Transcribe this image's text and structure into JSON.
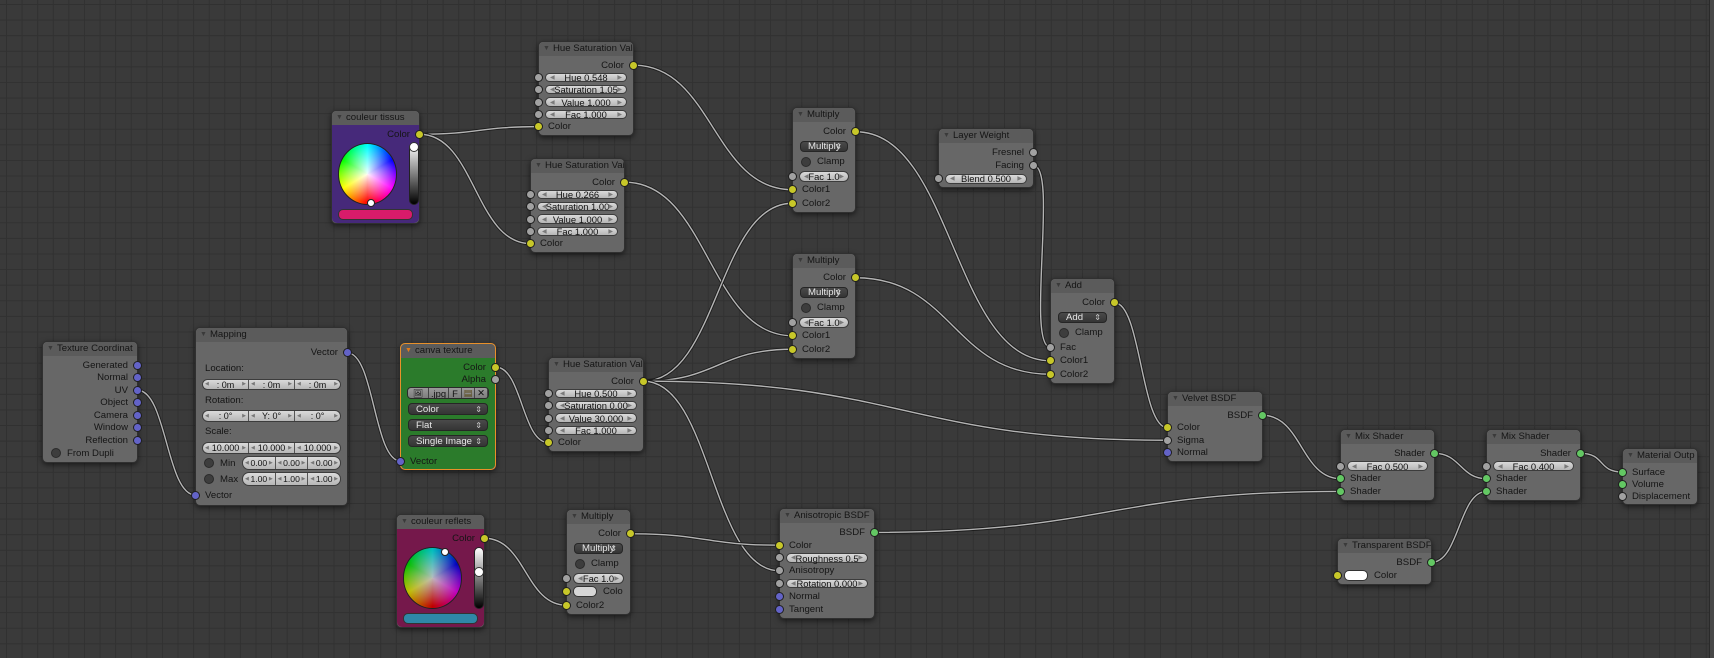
{
  "socket_colors": {
    "color": "#c7c729",
    "value": "#a1a1a1",
    "vector": "#6363c7",
    "shader": "#63c763"
  },
  "nodes": [
    {
      "id": "texcoord",
      "title": "Texture Coordinat",
      "rows": [
        {
          "t": "out",
          "label": "Generated",
          "sock": "vector"
        },
        {
          "t": "out",
          "label": "Normal",
          "sock": "vector"
        },
        {
          "t": "out",
          "label": "UV",
          "sock": "vector"
        },
        {
          "t": "out",
          "label": "Object",
          "sock": "vector"
        },
        {
          "t": "out",
          "label": "Camera",
          "sock": "vector"
        },
        {
          "t": "out",
          "label": "Window",
          "sock": "vector"
        },
        {
          "t": "out",
          "label": "Reflection",
          "sock": "vector"
        },
        {
          "t": "check",
          "label": "From Dupli"
        }
      ]
    },
    {
      "id": "mapping",
      "title": "Mapping",
      "rows": [
        {
          "t": "out",
          "label": "Vector",
          "sock": "vector"
        },
        {
          "t": "label",
          "label": "Location:"
        },
        {
          "t": "vec3",
          "values": [
            ": 0m",
            ": 0m",
            ": 0m"
          ]
        },
        {
          "t": "label",
          "label": "Rotation:"
        },
        {
          "t": "vec3",
          "values": [
            ": 0°",
            "Y: 0°",
            ": 0°"
          ]
        },
        {
          "t": "label",
          "label": "Scale:"
        },
        {
          "t": "vec3",
          "values": [
            "10.000",
            "10.000",
            "10.000"
          ]
        },
        {
          "t": "minmax",
          "label": "Min",
          "values": [
            "0.00",
            "0.00",
            "0.00"
          ]
        },
        {
          "t": "minmax",
          "label": "Max",
          "values": [
            "1.00",
            "1.00",
            "1.00"
          ]
        },
        {
          "t": "in",
          "label": "Vector",
          "sock": "vector"
        }
      ]
    },
    {
      "id": "canva",
      "title": "canva texture",
      "selected": true,
      "body_color": "#2b7b2b",
      "rows": [
        {
          "t": "out",
          "label": "Color",
          "sock": "color"
        },
        {
          "t": "out",
          "label": "Alpha",
          "sock": "value"
        },
        {
          "t": "imgbar",
          "ext": ".jpg",
          "f": "F"
        },
        {
          "t": "select",
          "label": "Color"
        },
        {
          "t": "select",
          "label": "Flat"
        },
        {
          "t": "select",
          "label": "Single Image"
        },
        {
          "t": "spacer"
        },
        {
          "t": "in",
          "label": "Vector",
          "sock": "vector"
        }
      ]
    },
    {
      "id": "tissus",
      "title": "couleur tissus",
      "body_color": "#46297a",
      "rows": [
        {
          "t": "out",
          "label": "Color",
          "sock": "color"
        },
        {
          "t": "picker",
          "value_level": 0.95,
          "dim": 0
        },
        {
          "t": "swatch",
          "color": "#d81b6a"
        }
      ]
    },
    {
      "id": "reflets",
      "title": "couleur reflets",
      "body_color": "#75184b",
      "rows": [
        {
          "t": "out",
          "label": "Color",
          "sock": "color"
        },
        {
          "t": "picker",
          "value_level": 0.6,
          "dim": 0.25
        },
        {
          "t": "swatch",
          "color": "#2f87a7"
        }
      ]
    },
    {
      "id": "hsv1",
      "title": "Hue Saturation Val",
      "rows": [
        {
          "t": "out",
          "label": "Color",
          "sock": "color"
        },
        {
          "t": "field",
          "name": "Hue",
          "value": "0.548",
          "sock": "value"
        },
        {
          "t": "field",
          "name": "Saturation",
          "value": "1.05",
          "sock": "value"
        },
        {
          "t": "field",
          "name": "Value",
          "value": "1.000",
          "sock": "value"
        },
        {
          "t": "field",
          "name": "Fac",
          "value": "1.000",
          "sock": "value"
        },
        {
          "t": "in",
          "label": "Color",
          "sock": "color"
        }
      ]
    },
    {
      "id": "hsv2",
      "title": "Hue Saturation Val",
      "rows": [
        {
          "t": "out",
          "label": "Color",
          "sock": "color"
        },
        {
          "t": "field",
          "name": "Hue",
          "value": "0.266",
          "sock": "value"
        },
        {
          "t": "field",
          "name": "Saturation",
          "value": "1.00",
          "sock": "value"
        },
        {
          "t": "field",
          "name": "Value",
          "value": "1.000",
          "sock": "value"
        },
        {
          "t": "field",
          "name": "Fac",
          "value": "1.000",
          "sock": "value"
        },
        {
          "t": "in",
          "label": "Color",
          "sock": "color"
        }
      ]
    },
    {
      "id": "hsv3",
      "title": "Hue Saturation Val",
      "rows": [
        {
          "t": "out",
          "label": "Color",
          "sock": "color"
        },
        {
          "t": "field",
          "name": "Hue",
          "value": "0.500",
          "sock": "value"
        },
        {
          "t": "field",
          "name": "Saturation",
          "value": "0.00",
          "sock": "value"
        },
        {
          "t": "field",
          "name": "Value",
          "value": "30.000",
          "sock": "value"
        },
        {
          "t": "field",
          "name": "Fac",
          "value": "1.000",
          "sock": "value"
        },
        {
          "t": "in",
          "label": "Color",
          "sock": "color"
        }
      ]
    },
    {
      "id": "mult1",
      "title": "Multiply",
      "rows": [
        {
          "t": "out",
          "label": "Color",
          "sock": "color"
        },
        {
          "t": "select",
          "label": "Multiply"
        },
        {
          "t": "check",
          "label": "Clamp"
        },
        {
          "t": "field",
          "name": "Fac",
          "value": "1.0",
          "sock": "value"
        },
        {
          "t": "in",
          "label": "Color1",
          "sock": "color"
        },
        {
          "t": "in",
          "label": "Color2",
          "sock": "color"
        }
      ]
    },
    {
      "id": "mult2",
      "title": "Multiply",
      "rows": [
        {
          "t": "out",
          "label": "Color",
          "sock": "color"
        },
        {
          "t": "select",
          "label": "Multiply"
        },
        {
          "t": "check",
          "label": "Clamp"
        },
        {
          "t": "field",
          "name": "Fac",
          "value": "1.0",
          "sock": "value"
        },
        {
          "t": "in",
          "label": "Color1",
          "sock": "color"
        },
        {
          "t": "in",
          "label": "Color2",
          "sock": "color"
        }
      ]
    },
    {
      "id": "mult3",
      "title": "Multiply",
      "rows": [
        {
          "t": "out",
          "label": "Color",
          "sock": "color"
        },
        {
          "t": "select",
          "label": "Multiply"
        },
        {
          "t": "check",
          "label": "Clamp"
        },
        {
          "t": "field",
          "name": "Fac",
          "value": "1.0",
          "sock": "value"
        },
        {
          "t": "colorin",
          "label": "Colo",
          "sock": "color",
          "swatch": "#d6d6d6"
        },
        {
          "t": "in",
          "label": "Color2",
          "sock": "color"
        }
      ]
    },
    {
      "id": "layer",
      "title": "Layer Weight",
      "rows": [
        {
          "t": "out",
          "label": "Fresnel",
          "sock": "value"
        },
        {
          "t": "out",
          "label": "Facing",
          "sock": "value"
        },
        {
          "t": "field",
          "name": "Blend",
          "value": "0.500",
          "sock": "value"
        }
      ]
    },
    {
      "id": "add",
      "title": "Add",
      "rows": [
        {
          "t": "out",
          "label": "Color",
          "sock": "color"
        },
        {
          "t": "select",
          "label": "Add"
        },
        {
          "t": "check",
          "label": "Clamp"
        },
        {
          "t": "in",
          "label": "Fac",
          "sock": "value"
        },
        {
          "t": "in",
          "label": "Color1",
          "sock": "color"
        },
        {
          "t": "in",
          "label": "Color2",
          "sock": "color"
        }
      ]
    },
    {
      "id": "velvet",
      "title": "Velvet BSDF",
      "rows": [
        {
          "t": "out",
          "label": "BSDF",
          "sock": "shader"
        },
        {
          "t": "in",
          "label": "Color",
          "sock": "color"
        },
        {
          "t": "in",
          "label": "Sigma",
          "sock": "value"
        },
        {
          "t": "in",
          "label": "Normal",
          "sock": "vector"
        }
      ]
    },
    {
      "id": "aniso",
      "title": "Anisotropic BSDF",
      "rows": [
        {
          "t": "out",
          "label": "BSDF",
          "sock": "shader"
        },
        {
          "t": "in",
          "label": "Color",
          "sock": "color"
        },
        {
          "t": "field",
          "name": "Roughness",
          "value": "0.5",
          "sock": "value"
        },
        {
          "t": "in",
          "label": "Anisotropy",
          "sock": "value"
        },
        {
          "t": "field",
          "name": "Rotation",
          "value": "0.000",
          "sock": "value"
        },
        {
          "t": "in",
          "label": "Normal",
          "sock": "vector"
        },
        {
          "t": "in",
          "label": "Tangent",
          "sock": "vector"
        }
      ]
    },
    {
      "id": "mix1",
      "title": "Mix Shader",
      "rows": [
        {
          "t": "out",
          "label": "Shader",
          "sock": "shader"
        },
        {
          "t": "field",
          "name": "Fac",
          "value": "0.500",
          "sock": "value"
        },
        {
          "t": "in",
          "label": "Shader",
          "sock": "shader"
        },
        {
          "t": "in",
          "label": "Shader",
          "sock": "shader"
        }
      ]
    },
    {
      "id": "mix2",
      "title": "Mix Shader",
      "rows": [
        {
          "t": "out",
          "label": "Shader",
          "sock": "shader"
        },
        {
          "t": "field",
          "name": "Fac",
          "value": "0.400",
          "sock": "value"
        },
        {
          "t": "in",
          "label": "Shader",
          "sock": "shader"
        },
        {
          "t": "in",
          "label": "Shader",
          "sock": "shader"
        }
      ]
    },
    {
      "id": "output",
      "title": "Material Outp",
      "rows": [
        {
          "t": "in",
          "label": "Surface",
          "sock": "shader"
        },
        {
          "t": "in",
          "label": "Volume",
          "sock": "shader"
        },
        {
          "t": "in",
          "label": "Displacement",
          "sock": "value"
        }
      ]
    },
    {
      "id": "transp",
      "title": "Transparent BSDF",
      "rows": [
        {
          "t": "out",
          "label": "BSDF",
          "sock": "shader"
        },
        {
          "t": "colorin",
          "label": "Color",
          "sock": "color",
          "swatch": "#ffffff"
        }
      ]
    }
  ],
  "links": [
    [
      "texcoord/o/UV",
      "mapping/i/Vector"
    ],
    [
      "mapping/o/Vector",
      "canva/i/Vector"
    ],
    [
      "canva/o/Color",
      "hsv3/i/Color"
    ],
    [
      "tissus/o/Color",
      "hsv1/i/Color"
    ],
    [
      "tissus/o/Color",
      "hsv2/i/Color"
    ],
    [
      "hsv1/o/Color",
      "mult1/i/Color1"
    ],
    [
      "hsv2/o/Color",
      "mult2/i/Color1"
    ],
    [
      "hsv3/o/Color",
      "mult1/i/Color2"
    ],
    [
      "hsv3/o/Color",
      "mult2/i/Color2"
    ],
    [
      "hsv3/o/Color",
      "velvet/i/Sigma"
    ],
    [
      "hsv3/o/Color",
      "aniso/i/Anisotropy"
    ],
    [
      "reflets/o/Color",
      "mult3/i/Color2"
    ],
    [
      "mult3/o/Color",
      "aniso/i/Color"
    ],
    [
      "mult1/o/Color",
      "add/i/Color1"
    ],
    [
      "mult2/o/Color",
      "add/i/Color2"
    ],
    [
      "layer/o/Facing",
      "add/i/Fac"
    ],
    [
      "add/o/Color",
      "velvet/i/Color"
    ],
    [
      "velvet/o/BSDF",
      "mix1/i/Shader"
    ],
    [
      "aniso/o/BSDF",
      "mix1/i/Shader#2"
    ],
    [
      "mix1/o/Shader",
      "mix2/i/Shader"
    ],
    [
      "transp/o/BSDF",
      "mix2/i/Shader#2"
    ],
    [
      "mix2/o/Shader",
      "output/i/Surface"
    ]
  ]
}
